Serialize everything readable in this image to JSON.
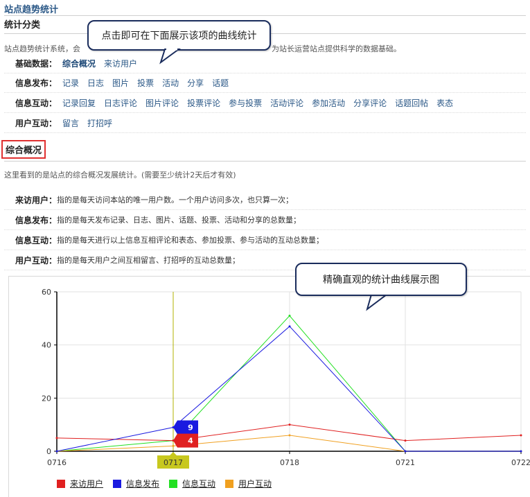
{
  "page_title": "站点趋势统计",
  "category_title": "统计分类",
  "category_desc": "站点趋势统计系统，会",
  "category_desc_tail": "为站长运营站点提供科学的数据基础。",
  "nav_rows": [
    {
      "label": "基础数据：",
      "links": [
        {
          "text": "综合概况",
          "active": true
        },
        {
          "text": "来访用户",
          "active": false
        }
      ]
    },
    {
      "label": "信息发布：",
      "links": [
        {
          "text": "记录"
        },
        {
          "text": "日志"
        },
        {
          "text": "图片"
        },
        {
          "text": "投票"
        },
        {
          "text": "活动"
        },
        {
          "text": "分享"
        },
        {
          "text": "话题"
        }
      ]
    },
    {
      "label": "信息互动：",
      "links": [
        {
          "text": "记录回复"
        },
        {
          "text": "日志评论"
        },
        {
          "text": "图片评论"
        },
        {
          "text": "投票评论"
        },
        {
          "text": "参与投票"
        },
        {
          "text": "活动评论"
        },
        {
          "text": "参加活动"
        },
        {
          "text": "分享评论"
        },
        {
          "text": "话题回帖"
        },
        {
          "text": "表态"
        }
      ]
    },
    {
      "label": "用户互动：",
      "links": [
        {
          "text": "留言"
        },
        {
          "text": "打招呼"
        }
      ]
    }
  ],
  "overview_title": "综合概况",
  "overview_desc": "这里看到的是站点的综合概况发展统计。(需要至少统计2天后才有效)",
  "info_rows": [
    {
      "label": "来访用户：",
      "text": "指的是每天访问本站的唯一用户数。一个用户访问多次，也只算一次；"
    },
    {
      "label": "信息发布：",
      "text": "指的是每天发布记录、日志、图片、话题、投票、活动和分享的总数量；"
    },
    {
      "label": "信息互动：",
      "text": "指的是每天进行以上信息互相评论和表态、参加投票、参与活动的互动总数量；"
    },
    {
      "label": "用户互动：",
      "text": "指的是每天用户之间互相留言、打招呼的互动总数量；"
    }
  ],
  "callouts": {
    "top": "点击即可在下面展示该项的曲线统计",
    "chart": "精确直观的统计曲线展示图"
  },
  "chart_data": {
    "type": "line",
    "x": [
      "0716",
      "0717",
      "0718",
      "0721",
      "0722"
    ],
    "ylim": [
      0,
      60
    ],
    "yticks": [
      0,
      20,
      40,
      60
    ],
    "highlight_x": "0717",
    "series": [
      {
        "name": "来访用户",
        "color": "#e02020",
        "values": [
          5,
          4,
          10,
          4,
          6
        ]
      },
      {
        "name": "信息发布",
        "color": "#1a1ae0",
        "values": [
          0,
          9,
          47,
          0,
          0
        ]
      },
      {
        "name": "信息互动",
        "color": "#22e022",
        "values": [
          0,
          4,
          51,
          0,
          0
        ]
      },
      {
        "name": "用户互动",
        "color": "#f0a020",
        "values": [
          0,
          2,
          6,
          0,
          0
        ]
      }
    ],
    "point_labels": [
      {
        "series": "信息发布",
        "x": "0717",
        "value": "9"
      },
      {
        "series": "来访用户",
        "x": "0717",
        "value": "4"
      }
    ]
  },
  "colors": {
    "link": "#2b5887",
    "highlight_box": "#e03030",
    "highlight_line": "#b0b000",
    "highlight_tag": "#c8c81e"
  }
}
